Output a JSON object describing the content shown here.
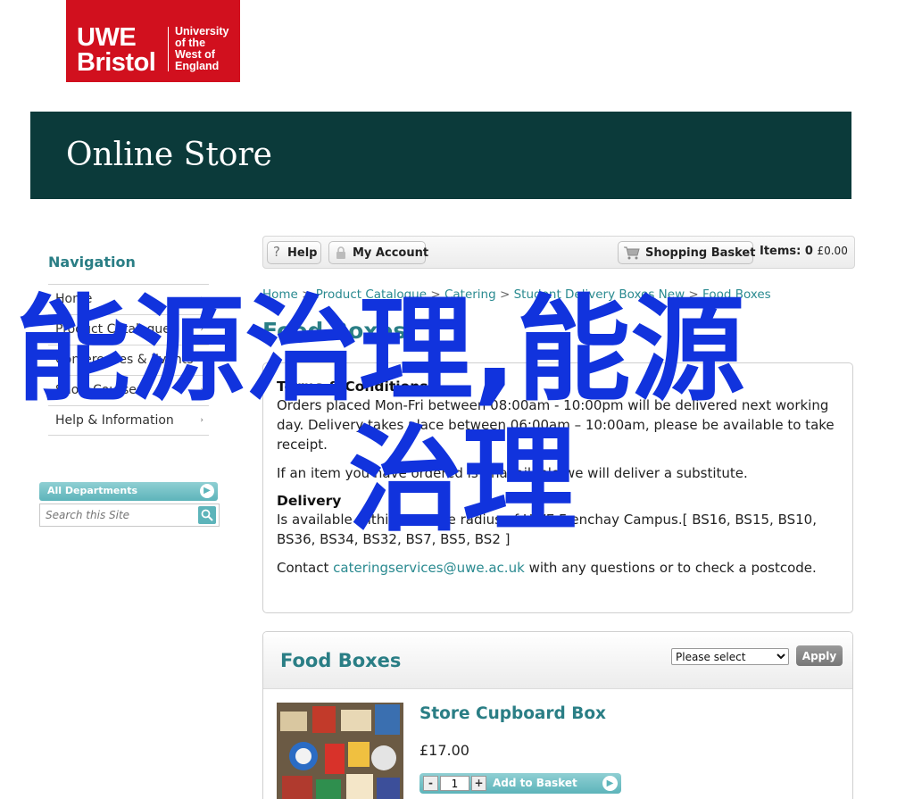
{
  "logo": {
    "uwe": "UWE",
    "bristol": "Bristol",
    "university_lines": [
      "University",
      "of the",
      "West of",
      "England"
    ],
    "color": "#d1101e"
  },
  "banner": {
    "title": "Online Store",
    "color": "#0b3a3a"
  },
  "navigation": {
    "heading": "Navigation",
    "items": [
      {
        "label": "Home",
        "arrow": "›"
      },
      {
        "label": "Product Catalogue",
        "arrow": "›"
      },
      {
        "label": "Conferences & Events",
        "arrow": "›"
      },
      {
        "label": "Short Courses",
        "arrow": "›"
      },
      {
        "label": "Help & Information",
        "arrow": "›"
      }
    ]
  },
  "departments": {
    "label": "All Departments",
    "icon": "chevron-right-circle-icon"
  },
  "search": {
    "placeholder": "Search this Site",
    "icon": "magnifier-icon"
  },
  "toolbar": {
    "help_label": "Help",
    "account_label": "My Account",
    "basket_label": "Shopping Basket",
    "items_label": "Items:",
    "items_count": "0",
    "basket_total": "£0.00"
  },
  "breadcrumb": {
    "items": [
      "Home",
      "Product Catalogue",
      "Catering",
      "Student Delivery Boxes New",
      "Food Boxes"
    ],
    "separator": ">"
  },
  "page_title": "Food Boxes",
  "info": {
    "terms_heading": "Terms & Conditions",
    "terms_text": "Orders placed Mon-Fri between 08:00am - 10:00pm will be delivered next working day. Delivery takes place between 06:00am – 10:00am, please be available to take receipt.",
    "substitute_text": "If an item you have ordered is unavailable we will deliver a substitute.",
    "delivery_heading": "Delivery",
    "delivery_text": "Is available within a 3-mile radius of UWE Frenchay Campus.[ BS16, BS15, BS10, BS36, BS34, BS32, BS7, BS5, BS2 ]",
    "contact_prefix": "Contact",
    "contact_email": "cateringservices@uwe.ac.uk",
    "contact_suffix": "with any questions or to check a postcode."
  },
  "product_panel": {
    "title": "Food Boxes",
    "sort_selected": "Please select",
    "apply_label": "Apply"
  },
  "product": {
    "name": "Store Cupboard Box",
    "price": "£17.00",
    "quantity": "1",
    "minus": "-",
    "plus": "+",
    "add_label": "Add to Basket"
  },
  "overlay": {
    "line1": "能源治理,能源",
    "line2": "治理",
    "color": "#1133dd"
  },
  "colors": {
    "accent_teal": "#2a7e85",
    "link_teal": "#2a8a90",
    "button_teal": "#5db4ba"
  }
}
